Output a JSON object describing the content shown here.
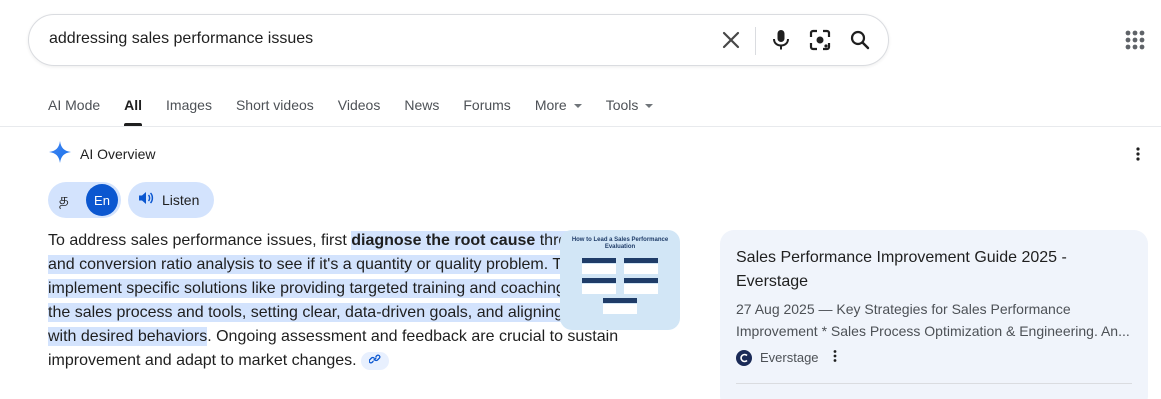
{
  "search": {
    "query": "addressing sales performance issues"
  },
  "icons": {
    "clear": "close-icon",
    "voice": "microphone-icon",
    "lens": "camera-lens-icon",
    "search": "search-icon",
    "apps": "apps-grid-icon",
    "ai": "sparkle-icon",
    "listen": "speaker-icon",
    "link": "link-icon",
    "more": "more-vert-icon"
  },
  "tabs": [
    {
      "label": "AI Mode"
    },
    {
      "label": "All"
    },
    {
      "label": "Images"
    },
    {
      "label": "Short videos"
    },
    {
      "label": "Videos"
    },
    {
      "label": "News"
    },
    {
      "label": "Forums"
    },
    {
      "label": "More"
    },
    {
      "label": "Tools"
    }
  ],
  "ai_overview": {
    "title": "AI Overview",
    "lang_native": "த",
    "lang_en": "En",
    "listen_label": "Listen",
    "text": {
      "intro": "To address sales performance issues, first ",
      "highlight_bold": "diagnose the root cause",
      "highlight_rest": " through activity and conversion ratio analysis to see if it's a quantity or quality problem. Then, implement specific solutions like providing targeted training and coaching, optimizing the sales process and tools, setting clear, data-driven goals, and aligning incentives with desired behaviors",
      "outro": ". Ongoing assessment and feedback are crucial to sustain improvement and adapt to market changes."
    },
    "thumbnail": {
      "title": "How to Lead a Sales Performance Evaluation"
    }
  },
  "source_card": {
    "title": "Sales Performance Improvement Guide 2025 - Everstage",
    "snippet": "27 Aug 2025 — Key Strategies for Sales Performance Improvement * Sales Process Optimization & Engineering. An...",
    "site": "Everstage"
  },
  "colors": {
    "highlight": "#d3e3fd",
    "accent": "#0b57d0",
    "card_bg": "#f0f4fb"
  }
}
